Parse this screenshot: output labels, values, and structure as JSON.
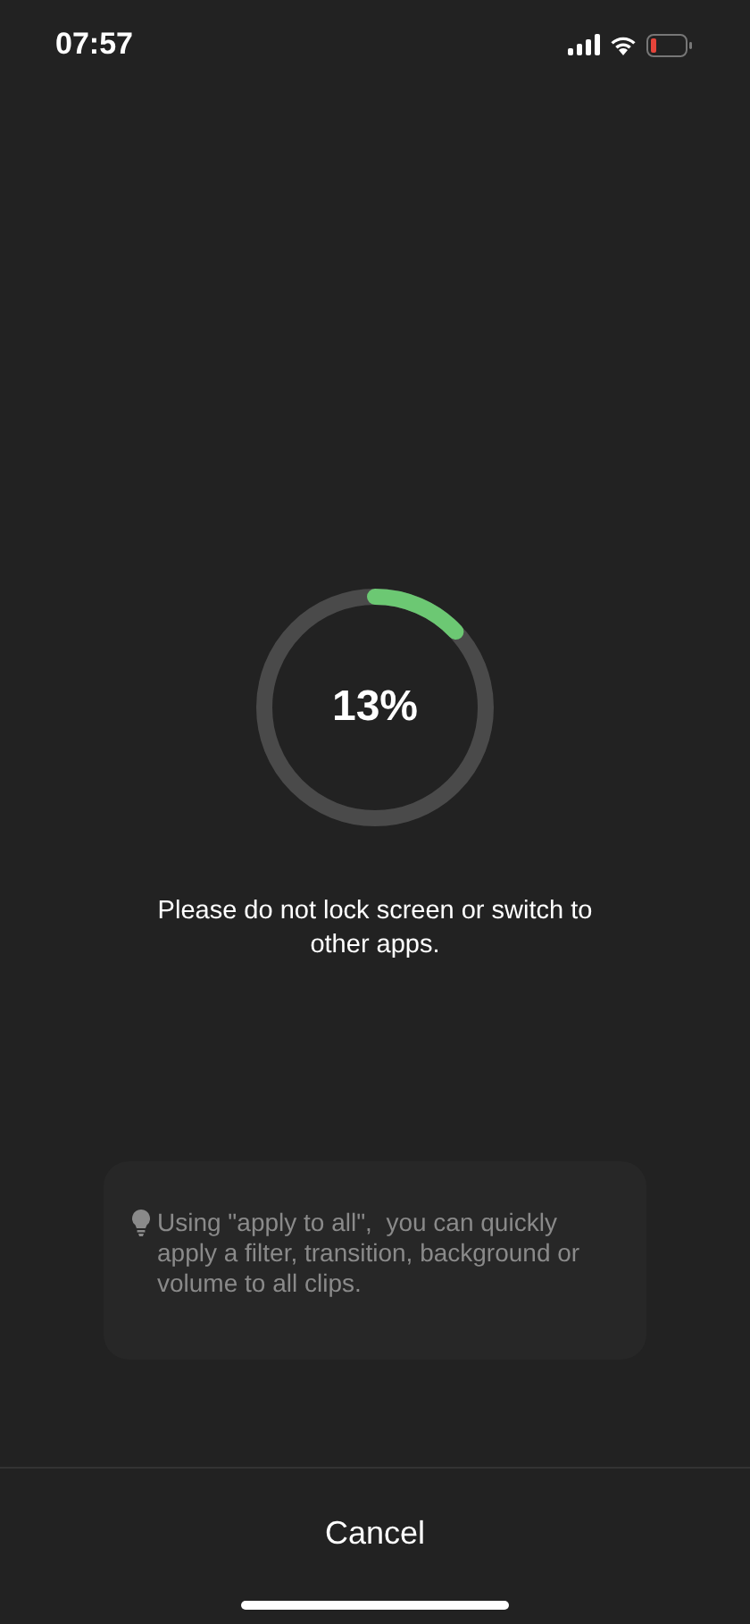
{
  "status_bar": {
    "time": "07:57"
  },
  "progress": {
    "percent": "13%"
  },
  "message": "Please do not lock screen or switch to other apps.",
  "tip": {
    "text": "Using \"apply to all\",  you can quickly apply a filter, transition, background or volume to all clips."
  },
  "cancel_button": "Cancel"
}
